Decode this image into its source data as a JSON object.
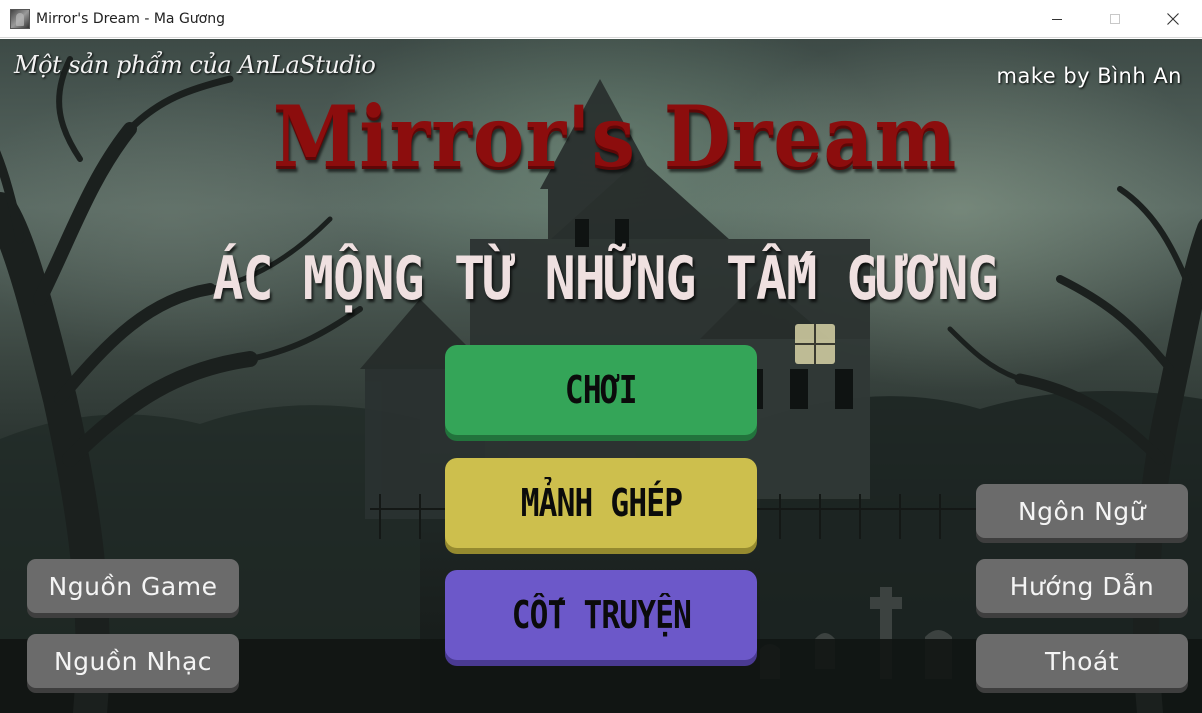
{
  "window": {
    "title": "Mirror's Dream - Ma Gương",
    "icon": "game-app-icon",
    "controls": [
      "minimize-icon",
      "maximize-icon",
      "close-icon"
    ]
  },
  "scene": {
    "credit_left": "Một sản phẩm của AnLaStudio",
    "credit_right": "make by Bình An",
    "title": "Mirror's Dream",
    "subtitle": "ÁC MỘNG TỪ NHỮNG TẤM GƯƠNG",
    "title_color": "#8c0d0d"
  },
  "main_menu": {
    "play": "CHƠI",
    "pieces": "MẢNH GHÉP",
    "story": "CỐT TRUYỆN",
    "colors": {
      "play": "#34a558",
      "pieces": "#cdbf4d",
      "story": "#6c58c9"
    }
  },
  "side_menu": {
    "game_source": "Nguồn Game",
    "music_source": "Nguồn Nhạc",
    "language": "Ngôn Ngữ",
    "guide": "Hướng Dẫn",
    "exit": "Thoát",
    "color": "#6b6b6b"
  }
}
